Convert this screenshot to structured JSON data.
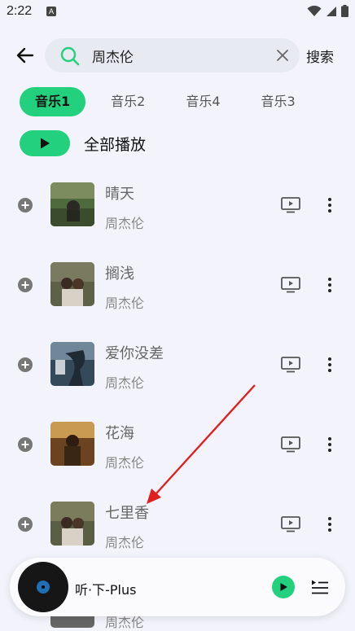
{
  "status_bar": {
    "time": "2:22",
    "notif_badge": "A"
  },
  "search": {
    "value": "周杰伦",
    "button_label": "搜索"
  },
  "tabs": [
    {
      "label": "音乐1",
      "active": true
    },
    {
      "label": "音乐2",
      "active": false
    },
    {
      "label": "音乐4",
      "active": false
    },
    {
      "label": "音乐3",
      "active": false
    }
  ],
  "play_all": {
    "label": "全部播放"
  },
  "songs": [
    {
      "title": "晴天",
      "artist": "周杰伦"
    },
    {
      "title": "搁浅",
      "artist": "周杰伦"
    },
    {
      "title": "爱你没差",
      "artist": "周杰伦"
    },
    {
      "title": "花海",
      "artist": "周杰伦"
    },
    {
      "title": "七里香",
      "artist": "周杰伦"
    }
  ],
  "partial_song": {
    "artist": "周杰伦"
  },
  "player": {
    "title": "听·下-Plus"
  },
  "colors": {
    "accent": "#22d07d",
    "background": "#f3f4fb",
    "annotation_arrow": "#e02020"
  }
}
